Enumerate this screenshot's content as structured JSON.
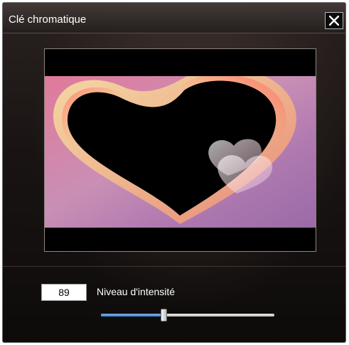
{
  "window": {
    "title": "Clé chromatique",
    "close_icon": "close-icon"
  },
  "preview": {
    "image": "heart-image"
  },
  "intensity": {
    "value": "89",
    "label": "Niveau d'intensité",
    "slider_fraction": 0.36
  },
  "colors": {
    "slider_fill": "#4a8ad6",
    "background": "#1a1514"
  }
}
